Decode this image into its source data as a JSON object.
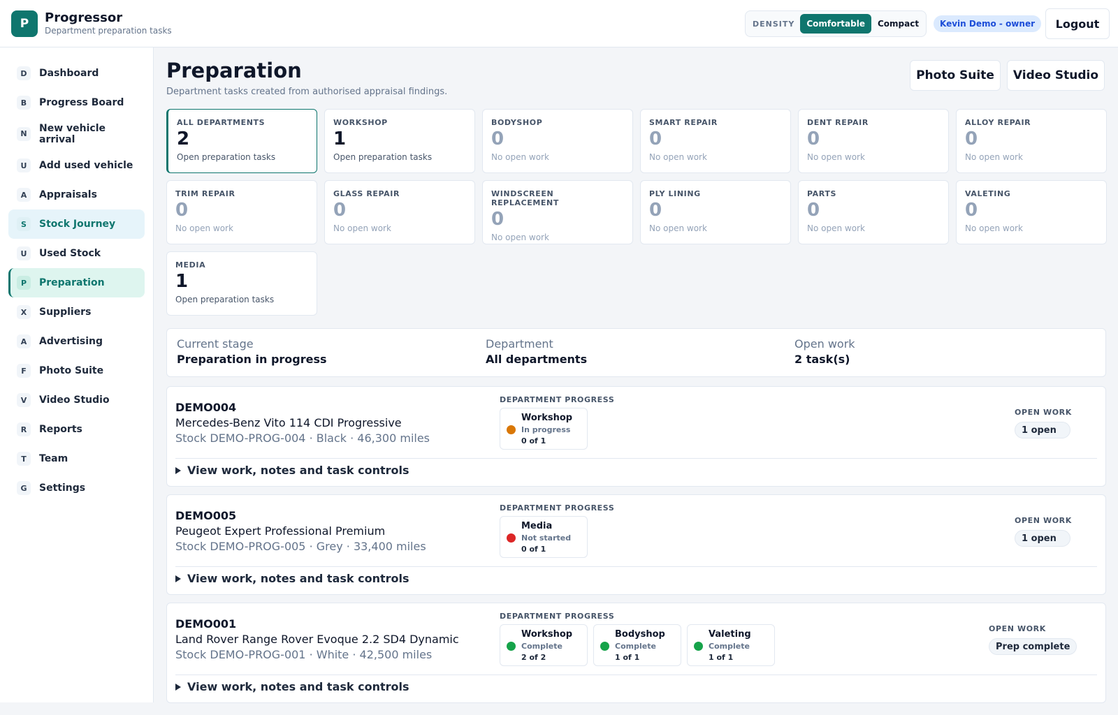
{
  "header": {
    "logo_letter": "P",
    "app_name": "Progressor",
    "app_subtitle": "Department preparation tasks",
    "density_label": "DENSITY",
    "density_options": [
      "Comfortable",
      "Compact"
    ],
    "density_selected": "Comfortable",
    "user_badge": "Kevin Demo - owner",
    "logout_label": "Logout"
  },
  "sidebar": {
    "items": [
      {
        "letter": "D",
        "label": "Dashboard"
      },
      {
        "letter": "B",
        "label": "Progress Board"
      },
      {
        "letter": "N",
        "label": "New vehicle arrival"
      },
      {
        "letter": "U",
        "label": "Add used vehicle"
      },
      {
        "letter": "A",
        "label": "Appraisals"
      },
      {
        "letter": "S",
        "label": "Stock Journey"
      },
      {
        "letter": "U",
        "label": "Used Stock"
      },
      {
        "letter": "P",
        "label": "Preparation"
      },
      {
        "letter": "X",
        "label": "Suppliers"
      },
      {
        "letter": "A",
        "label": "Advertising"
      },
      {
        "letter": "F",
        "label": "Photo Suite"
      },
      {
        "letter": "V",
        "label": "Video Studio"
      },
      {
        "letter": "R",
        "label": "Reports"
      },
      {
        "letter": "T",
        "label": "Team"
      },
      {
        "letter": "G",
        "label": "Settings"
      }
    ]
  },
  "page": {
    "title": "Preparation",
    "subtitle": "Department tasks created from authorised appraisal findings.",
    "photo_suite_label": "Photo Suite",
    "video_studio_label": "Video Studio"
  },
  "departments": [
    {
      "label": "ALL DEPARTMENTS",
      "count": "2",
      "note": "Open preparation tasks"
    },
    {
      "label": "WORKSHOP",
      "count": "1",
      "note": "Open preparation tasks"
    },
    {
      "label": "BODYSHOP",
      "count": "0",
      "note": "No open work"
    },
    {
      "label": "SMART REPAIR",
      "count": "0",
      "note": "No open work"
    },
    {
      "label": "DENT REPAIR",
      "count": "0",
      "note": "No open work"
    },
    {
      "label": "ALLOY REPAIR",
      "count": "0",
      "note": "No open work"
    },
    {
      "label": "TRIM REPAIR",
      "count": "0",
      "note": "No open work"
    },
    {
      "label": "GLASS REPAIR",
      "count": "0",
      "note": "No open work"
    },
    {
      "label": "WINDSCREEN REPLACEMENT",
      "count": "0",
      "note": "No open work"
    },
    {
      "label": "PLY LINING",
      "count": "0",
      "note": "No open work"
    },
    {
      "label": "PARTS",
      "count": "0",
      "note": "No open work"
    },
    {
      "label": "VALETING",
      "count": "0",
      "note": "No open work"
    },
    {
      "label": "MEDIA",
      "count": "1",
      "note": "Open preparation tasks"
    }
  ],
  "summary": {
    "stage_label": "Current stage",
    "stage_value": "Preparation in progress",
    "department_label": "Department",
    "department_value": "All departments",
    "open_label": "Open work",
    "open_value": "2 task(s)"
  },
  "dept_progress_title": "DEPARTMENT PROGRESS",
  "open_work_title": "OPEN WORK",
  "toggle_label": "View work, notes and task controls",
  "colors": {
    "accent": "#0f766e",
    "in_progress": "#d97706",
    "not_started": "#dc2626",
    "complete": "#16a34a"
  },
  "vehicles": [
    {
      "reg": "DEMO004",
      "model": "Mercedes-Benz Vito 114 CDI Progressive",
      "meta": "Stock DEMO-PROG-004 · Black · 46,300 miles",
      "open_work": "1 open",
      "departments": [
        {
          "name": "Workshop",
          "status": "In progress",
          "count": "0 of 1",
          "color": "#d97706"
        }
      ]
    },
    {
      "reg": "DEMO005",
      "model": "Peugeot Expert Professional Premium",
      "meta": "Stock DEMO-PROG-005 · Grey · 33,400 miles",
      "open_work": "1 open",
      "departments": [
        {
          "name": "Media",
          "status": "Not started",
          "count": "0 of 1",
          "color": "#dc2626"
        }
      ]
    },
    {
      "reg": "DEMO001",
      "model": "Land Rover Range Rover Evoque 2.2 SD4 Dynamic",
      "meta": "Stock DEMO-PROG-001 · White · 42,500 miles",
      "open_work": "Prep complete",
      "departments": [
        {
          "name": "Workshop",
          "status": "Complete",
          "count": "2 of 2",
          "color": "#16a34a"
        },
        {
          "name": "Bodyshop",
          "status": "Complete",
          "count": "1 of 1",
          "color": "#16a34a"
        },
        {
          "name": "Valeting",
          "status": "Complete",
          "count": "1 of 1",
          "color": "#16a34a"
        }
      ]
    }
  ]
}
